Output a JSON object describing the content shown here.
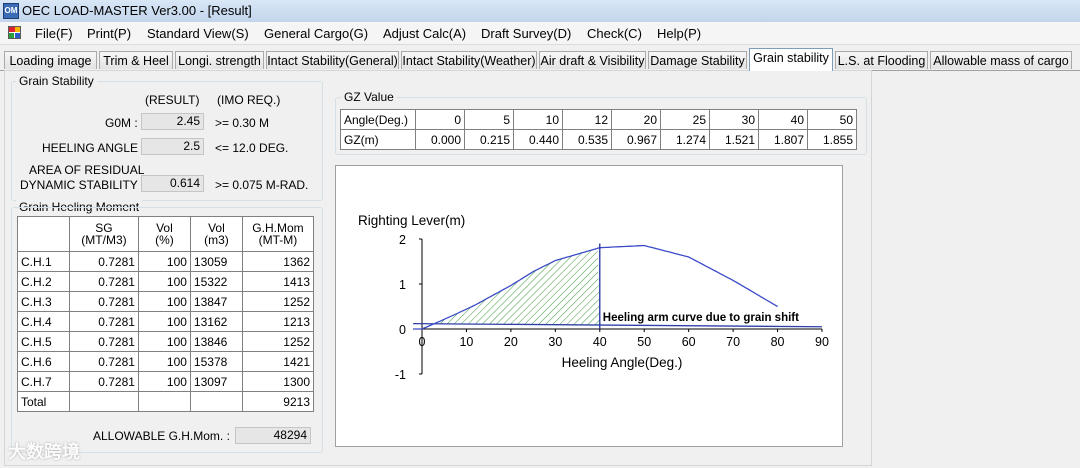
{
  "window": {
    "title": "OEC LOAD-MASTER Ver3.00 - [Result]",
    "icon": "app-logo-icon"
  },
  "menu": [
    "File(F)",
    "Print(P)",
    "Standard View(S)",
    "General Cargo(G)",
    "Adjust Calc(A)",
    "Draft Survey(D)",
    "Check(C)",
    "Help(P)"
  ],
  "tabs": [
    "Loading image",
    "Trim & Heel",
    "Longi. strength",
    "Intact Stability(General)",
    "Intact Stability(Weather)",
    "Air draft & Visibility",
    "Damage Stability",
    "Grain stability",
    "L.S. at Flooding",
    "Allowable mass of cargo"
  ],
  "active_tab": "Grain stability",
  "grain_stability": {
    "caption": "Grain Stability",
    "col_result": "(RESULT)",
    "col_imo": "(IMO REQ.)",
    "gom_label": "G0M :",
    "gom_value": "2.45",
    "gom_req": ">= 0.30 M",
    "heel_label": "HEELING ANGLE",
    "heel_value": "2.5",
    "heel_req": "<= 12.0 DEG.",
    "area_label_1": "AREA OF RESIDUAL",
    "area_label_2": "DYNAMIC STABILITY :",
    "area_value": "0.614",
    "area_req": ">= 0.075 M-RAD."
  },
  "heeling_moment": {
    "caption": "Grain Heeling Moment",
    "headers": [
      [
        "",
        ""
      ],
      [
        "SG",
        "(MT/M3)"
      ],
      [
        "Vol",
        "(%)"
      ],
      [
        "Vol",
        "(m3)"
      ],
      [
        "G.H.Mom",
        "(MT-M)"
      ]
    ],
    "rows": [
      [
        "C.H.1",
        "0.7281",
        "100",
        "13059",
        "1362"
      ],
      [
        "C.H.2",
        "0.7281",
        "100",
        "15322",
        "1413"
      ],
      [
        "C.H.3",
        "0.7281",
        "100",
        "13847",
        "1252"
      ],
      [
        "C.H.4",
        "0.7281",
        "100",
        "13162",
        "1213"
      ],
      [
        "C.H.5",
        "0.7281",
        "100",
        "13846",
        "1252"
      ],
      [
        "C.H.6",
        "0.7281",
        "100",
        "15378",
        "1421"
      ],
      [
        "C.H.7",
        "0.7281",
        "100",
        "13097",
        "1300"
      ],
      [
        "Total",
        "",
        "",
        "",
        "9213"
      ]
    ],
    "allowable_label": "ALLOWABLE G.H.Mom. :",
    "allowable_value": "48294"
  },
  "gz_value": {
    "caption": "GZ Value",
    "angle_label": "Angle(Deg.)",
    "gz_label": "GZ(m)",
    "angles": [
      "0",
      "5",
      "10",
      "12",
      "20",
      "25",
      "30",
      "40",
      "50"
    ],
    "gz": [
      "0.000",
      "0.215",
      "0.440",
      "0.535",
      "0.967",
      "1.274",
      "1.521",
      "1.807",
      "1.855"
    ]
  },
  "chart_data": {
    "type": "line",
    "ylabel": "Righting Lever(m)",
    "xlabel": "Heeling Angle(Deg.)",
    "xlim": [
      0,
      90
    ],
    "ylim": [
      -1,
      2
    ],
    "x_ticks": [
      "0",
      "10",
      "20",
      "30",
      "40",
      "50",
      "60",
      "70",
      "80",
      "90"
    ],
    "y_ticks": [
      "2",
      "1",
      "0",
      "-1"
    ],
    "series": [
      {
        "values": [
          [
            -2,
            0.0
          ],
          [
            0,
            0.0
          ],
          [
            5,
            0.215
          ],
          [
            10,
            0.44
          ],
          [
            12,
            0.535
          ],
          [
            20,
            0.967
          ],
          [
            25,
            1.274
          ],
          [
            30,
            1.521
          ],
          [
            40,
            1.807
          ],
          [
            50,
            1.855
          ],
          [
            60,
            1.6
          ],
          [
            70,
            1.08
          ],
          [
            80,
            0.5
          ]
        ]
      },
      {
        "name": "Heeling arm curve due to grain shift",
        "values": [
          [
            -2,
            0.12
          ],
          [
            90,
            0.05
          ]
        ]
      }
    ],
    "shaded_area": {
      "from": 2.5,
      "to": 40
    },
    "annotation": "Heeling arm curve due to grain shift",
    "colors": {
      "gz_curve": "#3b4bc8",
      "heeling_arm": "#2f3fa8",
      "hatch": "#3a9a3a",
      "vertical": "#1f2f9f"
    }
  },
  "watermark": "大数跨境"
}
